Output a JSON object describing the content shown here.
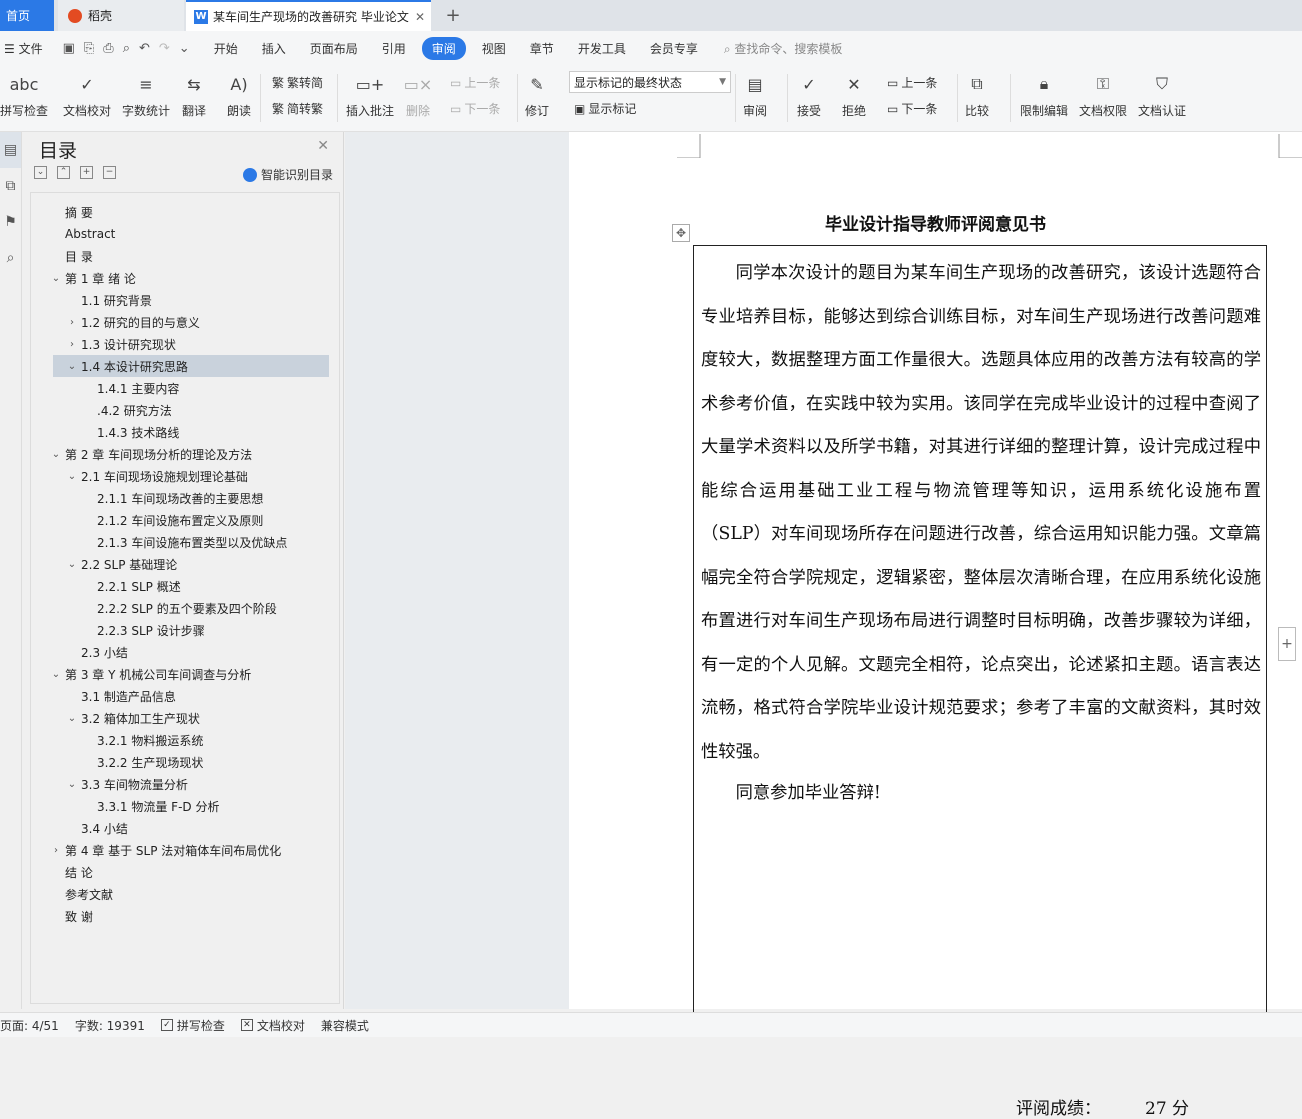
{
  "tabs": {
    "home": "首页",
    "daoke": "稻壳",
    "doc": "某车间生产现场的改善研究 毕业论文",
    "close": "✕",
    "add": "+"
  },
  "menu": {
    "file": "文件",
    "items": [
      "开始",
      "插入",
      "页面布局",
      "引用",
      "审阅",
      "视图",
      "章节",
      "开发工具",
      "会员专享"
    ],
    "active": "审阅",
    "search": "查找命令、搜索模板"
  },
  "ribbon": {
    "spell": "拼写检查",
    "proof": "文档校对",
    "wordcount": "字数统计",
    "translate": "翻译",
    "read": "朗读",
    "t2s": "繁转简",
    "s2t": "简转繁",
    "insert_comment": "插入批注",
    "delete": "删除",
    "prev_comment": "上一条",
    "next_comment": "下一条",
    "revise": "修订",
    "markup_state": "显示标记的最终状态",
    "show_markup": "显示标记",
    "review": "审阅",
    "accept": "接受",
    "reject": "拒绝",
    "prev_change": "上一条",
    "next_change": "下一条",
    "compare": "比较",
    "restrict": "限制编辑",
    "rights": "文档权限",
    "certify": "文档认证"
  },
  "nav": {
    "title": "目录",
    "smart": "智能识别目录",
    "items": [
      {
        "label": "摘  要",
        "level": 0,
        "caret": ""
      },
      {
        "label": "Abstract",
        "level": 0,
        "caret": ""
      },
      {
        "label": "目  录",
        "level": 0,
        "caret": ""
      },
      {
        "label": "第 1 章  绪    论",
        "level": 0,
        "caret": "⌄"
      },
      {
        "label": "1.1  研究背景",
        "level": 1,
        "caret": ""
      },
      {
        "label": "1.2  研究的目的与意义",
        "level": 1,
        "caret": "›"
      },
      {
        "label": "1.3  设计研究现状",
        "level": 1,
        "caret": "›"
      },
      {
        "label": "1.4  本设计研究思路",
        "level": 1,
        "caret": "⌄",
        "selected": true
      },
      {
        "label": "1.4.1  主要内容",
        "level": 2,
        "caret": ""
      },
      {
        "label": ".4.2  研究方法",
        "level": 2,
        "caret": ""
      },
      {
        "label": "1.4.3  技术路线",
        "level": 2,
        "caret": ""
      },
      {
        "label": "第 2 章  车间现场分析的理论及方法",
        "level": 0,
        "caret": "⌄"
      },
      {
        "label": "2.1  车间现场设施规划理论基础",
        "level": 1,
        "caret": "⌄"
      },
      {
        "label": "2.1.1  车间现场改善的主要思想",
        "level": 2,
        "caret": ""
      },
      {
        "label": "2.1.2  车间设施布置定义及原则",
        "level": 2,
        "caret": ""
      },
      {
        "label": "2.1.3  车间设施布置类型以及优缺点",
        "level": 2,
        "caret": ""
      },
      {
        "label": "2.2 SLP 基础理论",
        "level": 1,
        "caret": "⌄"
      },
      {
        "label": "2.2.1 SLP 概述",
        "level": 2,
        "caret": ""
      },
      {
        "label": "2.2.2 SLP 的五个要素及四个阶段",
        "level": 2,
        "caret": ""
      },
      {
        "label": "2.2.3 SLP 设计步骤",
        "level": 2,
        "caret": ""
      },
      {
        "label": "2.3  小结",
        "level": 1,
        "caret": ""
      },
      {
        "label": "第 3 章  Y 机械公司车间调查与分析",
        "level": 0,
        "caret": "⌄"
      },
      {
        "label": "3.1  制造产品信息",
        "level": 1,
        "caret": ""
      },
      {
        "label": "3.2  箱体加工生产现状",
        "level": 1,
        "caret": "⌄"
      },
      {
        "label": "3.2.1  物料搬运系统",
        "level": 2,
        "caret": ""
      },
      {
        "label": "3.2.2  生产现场现状",
        "level": 2,
        "caret": ""
      },
      {
        "label": "3.3  车间物流量分析",
        "level": 1,
        "caret": "⌄"
      },
      {
        "label": "3.3.1  物流量 F-D 分析",
        "level": 2,
        "caret": ""
      },
      {
        "label": "3.4  小结",
        "level": 1,
        "caret": ""
      },
      {
        "label": "第 4 章  基于 SLP 法对箱体车间布局优化",
        "level": 0,
        "caret": "›"
      },
      {
        "label": "结  论",
        "level": 0,
        "caret": ""
      },
      {
        "label": "参考文献",
        "level": 0,
        "caret": ""
      },
      {
        "label": "致  谢",
        "level": 0,
        "caret": ""
      }
    ]
  },
  "document": {
    "title": "毕业设计指导教师评阅意见书",
    "body": "同学本次设计的题目为某车间生产现场的改善研究，该设计选题符合专业培养目标，能够达到综合训练目标，对车间生产现场进行改善问题难度较大，数据整理方面工作量很大。选题具体应用的改善方法有较高的学术参考价值，在实践中较为实用。该同学在完成毕业设计的过程中查阅了大量学术资料以及所学书籍，对其进行详细的整理计算，设计完成过程中能综合运用基础工业工程与物流管理等知识，运用系统化设施布置（SLP）对车间现场所存在问题进行改善，综合运用知识能力强。文章篇幅完全符合学院规定，逻辑紧密，整体层次清晰合理，在应用系统化设施布置进行对车间生产现场布局进行调整时目标明确，改善步骤较为详细，有一定的个人见解。文题完全相符，论点突出，论述紧扣主题。语言表达流畅，格式符合学院毕业设计规范要求；参考了丰富的文献资料，其时效性较强。",
    "agree": "同意参加毕业答辩!",
    "score_label": "评阅成绩：",
    "score_value": "27 分"
  },
  "status": {
    "page": "页面: 4/51",
    "words": "字数: 19391",
    "spell": "拼写检查",
    "proof": "文档校对",
    "compat": "兼容模式"
  }
}
